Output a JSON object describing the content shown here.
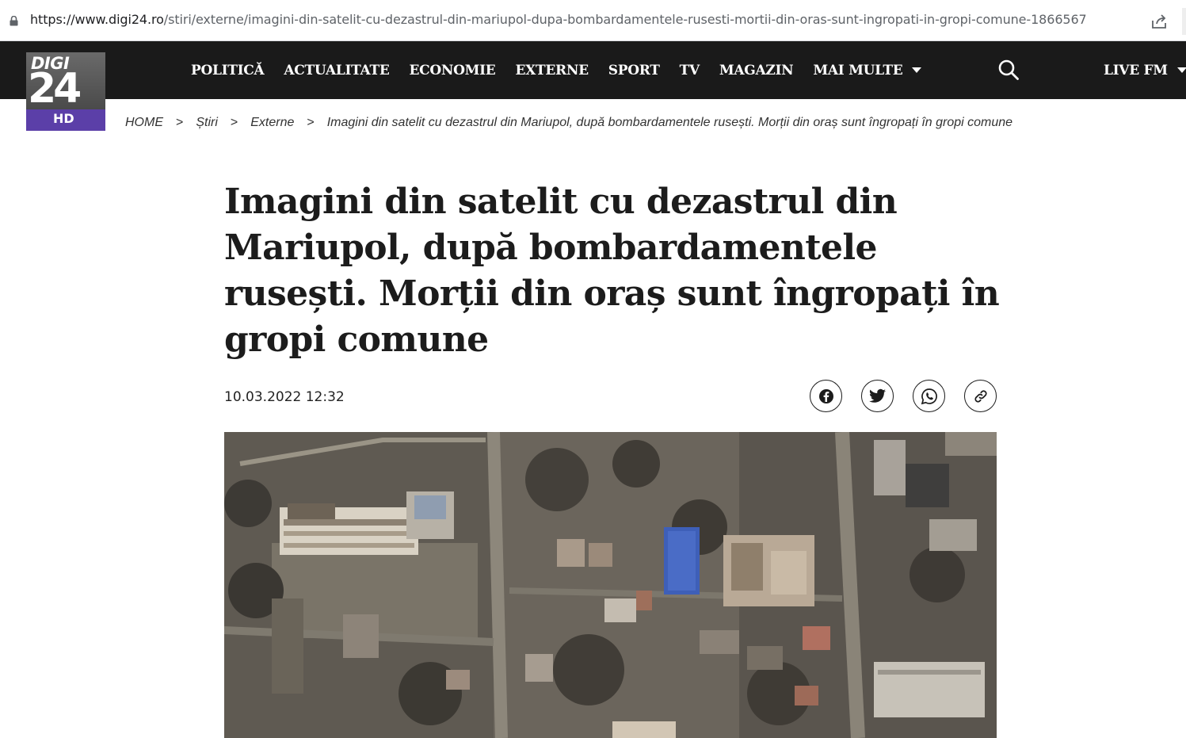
{
  "browser": {
    "url_host": "https://www.digi24.ro",
    "url_path": "/stiri/externe/imagini-din-satelit-cu-dezastrul-din-mariupol-dupa-bombardamentele-rusesti-mortii-din-oras-sunt-ingropati-in-gropi-comune-1866567",
    "icons": [
      "lock-icon",
      "share-icon"
    ]
  },
  "logo": {
    "top_text": "DIGI",
    "number": "24",
    "badge": "HD"
  },
  "nav": {
    "items": [
      "POLITICĂ",
      "ACTUALITATE",
      "ECONOMIE",
      "EXTERNE",
      "SPORT",
      "TV",
      "MAGAZIN"
    ],
    "more_label": "MAI MULTE",
    "live_label": "LIVE FM"
  },
  "breadcrumb": {
    "items": [
      "HOME",
      "Știri",
      "Externe",
      "Imagini din satelit cu dezastrul din Mariupol, după bombardamentele rusești. Morții din oraș sunt îngropați în gropi comune"
    ],
    "separator": ">"
  },
  "article": {
    "title": "Imagini din satelit cu dezastrul din Mariupol, după bombardamentele rusești. Morții din oraș sunt îngropați în gropi comune",
    "date": "10.03.2022 12:32",
    "share_buttons": [
      "facebook-icon",
      "twitter-icon",
      "whatsapp-icon",
      "link-icon"
    ]
  },
  "colors": {
    "nav_bg": "#1a1a1a",
    "logo_purple": "#5b3fa8",
    "text": "#1c1c1c"
  }
}
